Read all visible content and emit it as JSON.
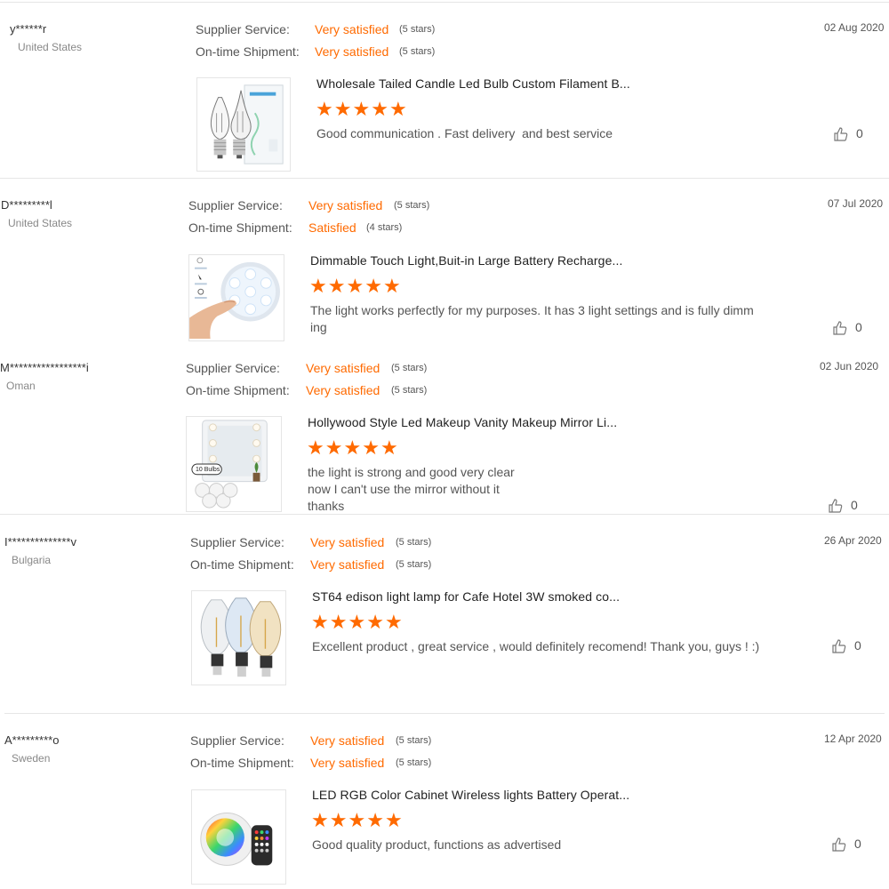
{
  "labels": {
    "supplier_service": "Supplier Service:",
    "on_time_shipment": "On-time Shipment:"
  },
  "reviews": [
    {
      "user": "y******r",
      "country": "United States",
      "supplier_service": "Very satisfied",
      "supplier_stars": "(5 stars)",
      "shipment": "Very satisfied",
      "shipment_stars": "(5 stars)",
      "date": "02 Aug 2020",
      "product_title": "Wholesale Tailed Candle Led Bulb Custom Filament B...",
      "rating": 5,
      "comment": "Good communication . Fast delivery  and best service",
      "likes": "0",
      "image_icon": "candle-bulb-product-image"
    },
    {
      "user": "D*********l",
      "country": "United States",
      "supplier_service": "Very satisfied",
      "supplier_stars": "(5 stars)",
      "shipment": "Satisfied",
      "shipment_stars": "(4 stars)",
      "date": "07 Jul 2020",
      "product_title": "Dimmable Touch Light,Buit-in Large Battery Recharge...",
      "rating": 5,
      "comment": "The light works perfectly for my purposes. It has 3 light settings and is fully dimm\ning",
      "likes": "0",
      "image_icon": "touch-light-product-image"
    },
    {
      "user": "M*****************i",
      "country": "Oman",
      "supplier_service": "Very satisfied",
      "supplier_stars": "(5 stars)",
      "shipment": "Very satisfied",
      "shipment_stars": "(5 stars)",
      "date": "02 Jun 2020",
      "product_title": "Hollywood Style Led Makeup Vanity Makeup Mirror Li...",
      "rating": 5,
      "comment": "the light is strong and good very clear\nnow I can't use the mirror without it\nthanks",
      "likes": "0",
      "image_icon": "vanity-mirror-product-image",
      "image_badge": "10 Bulbs"
    },
    {
      "user": "I**************v",
      "country": "Bulgaria",
      "supplier_service": "Very satisfied",
      "supplier_stars": "(5 stars)",
      "shipment": "Very satisfied",
      "shipment_stars": "(5 stars)",
      "date": "26 Apr 2020",
      "product_title": "ST64 edison light lamp for Cafe Hotel 3W smoked co...",
      "rating": 5,
      "comment": "Excellent product , great service , would definitely recomend! Thank you, guys ! :)",
      "likes": "0",
      "image_icon": "edison-bulbs-product-image"
    },
    {
      "user": "A*********o",
      "country": "Sweden",
      "supplier_service": "Very satisfied",
      "supplier_stars": "(5 stars)",
      "shipment": "Very satisfied",
      "shipment_stars": "(5 stars)",
      "date": "12 Apr 2020",
      "product_title": "LED RGB Color Cabinet Wireless lights Battery Operat...",
      "rating": 5,
      "comment": "Good quality product, functions as advertised",
      "likes": "0",
      "image_icon": "rgb-light-product-image"
    }
  ],
  "colors": {
    "accent": "#ff6a00",
    "divider": "#e6e6e6",
    "muted_text": "#888888"
  }
}
